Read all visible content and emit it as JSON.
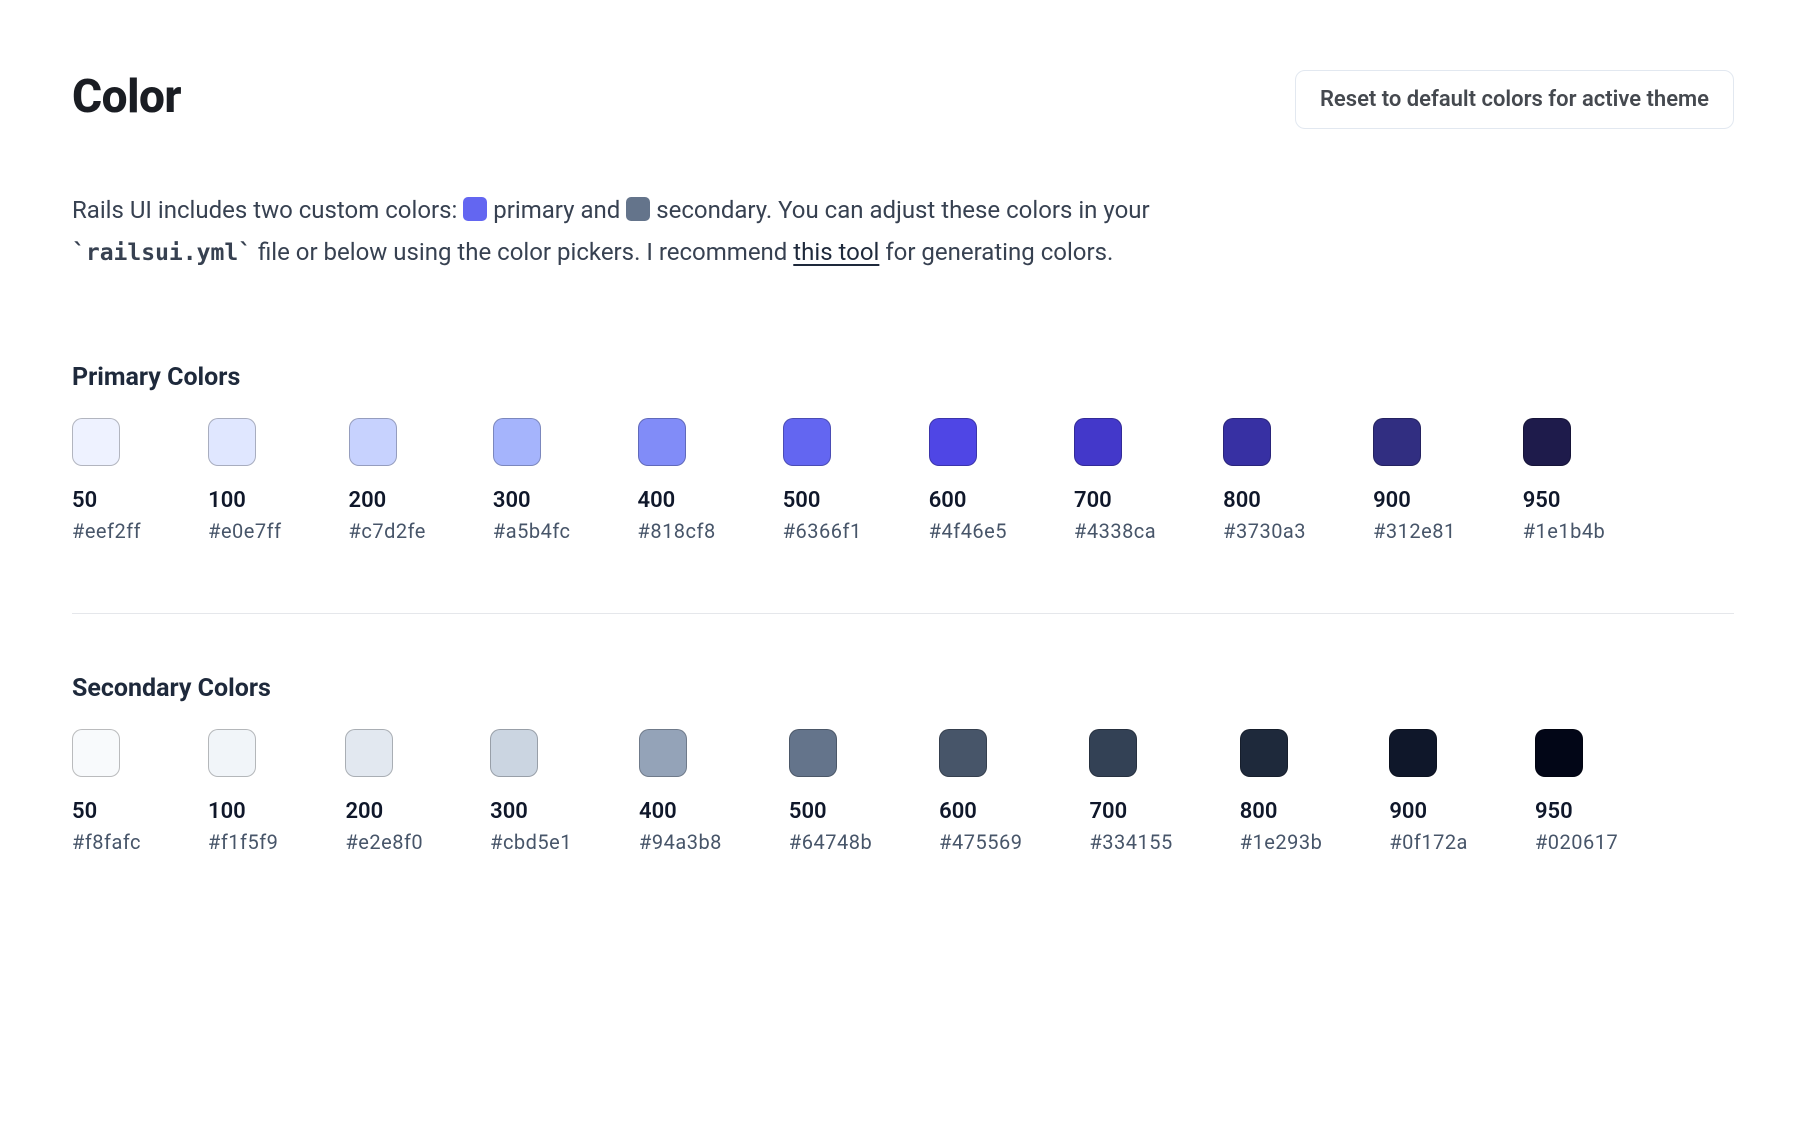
{
  "page": {
    "title": "Color",
    "reset_button": "Reset to default colors for active theme",
    "description": {
      "part1": "Rails UI includes two custom colors: ",
      "primary_label": " primary and ",
      "secondary_label": " secondary. You can adjust these colors in your ",
      "file": "`railsui.yml`",
      "part2": " file or below using the color pickers. I recommend ",
      "link_text": "this tool",
      "part3": " for generating colors."
    }
  },
  "sections": {
    "primary": {
      "title": "Primary Colors",
      "colors": [
        {
          "shade": "50",
          "hex": "#eef2ff"
        },
        {
          "shade": "100",
          "hex": "#e0e7ff"
        },
        {
          "shade": "200",
          "hex": "#c7d2fe"
        },
        {
          "shade": "300",
          "hex": "#a5b4fc"
        },
        {
          "shade": "400",
          "hex": "#818cf8"
        },
        {
          "shade": "500",
          "hex": "#6366f1"
        },
        {
          "shade": "600",
          "hex": "#4f46e5"
        },
        {
          "shade": "700",
          "hex": "#4338ca"
        },
        {
          "shade": "800",
          "hex": "#3730a3"
        },
        {
          "shade": "900",
          "hex": "#312e81"
        },
        {
          "shade": "950",
          "hex": "#1e1b4b"
        }
      ]
    },
    "secondary": {
      "title": "Secondary Colors",
      "colors": [
        {
          "shade": "50",
          "hex": "#f8fafc"
        },
        {
          "shade": "100",
          "hex": "#f1f5f9"
        },
        {
          "shade": "200",
          "hex": "#e2e8f0"
        },
        {
          "shade": "300",
          "hex": "#cbd5e1"
        },
        {
          "shade": "400",
          "hex": "#94a3b8"
        },
        {
          "shade": "500",
          "hex": "#64748b"
        },
        {
          "shade": "600",
          "hex": "#475569"
        },
        {
          "shade": "700",
          "hex": "#334155"
        },
        {
          "shade": "800",
          "hex": "#1e293b"
        },
        {
          "shade": "900",
          "hex": "#0f172a"
        },
        {
          "shade": "950",
          "hex": "#020617"
        }
      ]
    }
  }
}
